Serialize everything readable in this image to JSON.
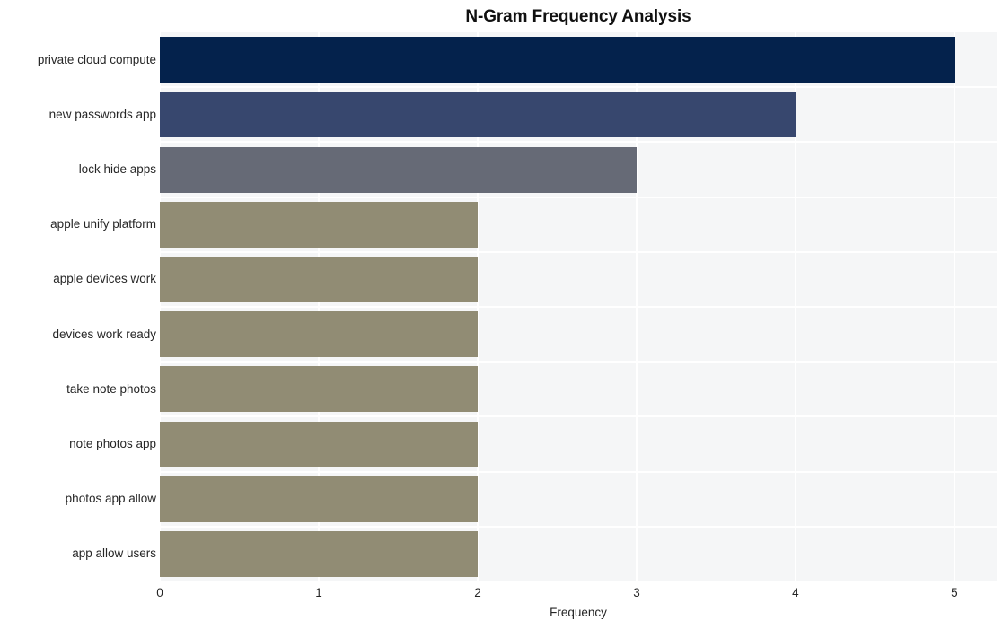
{
  "chart_data": {
    "type": "bar",
    "orientation": "horizontal",
    "title": "N-Gram Frequency Analysis",
    "xlabel": "Frequency",
    "ylabel": "",
    "categories": [
      "private cloud compute",
      "new passwords app",
      "lock hide apps",
      "apple unify platform",
      "apple devices work",
      "devices work ready",
      "take note photos",
      "note photos app",
      "photos app allow",
      "app allow users"
    ],
    "values": [
      5,
      4,
      3,
      2,
      2,
      2,
      2,
      2,
      2,
      2
    ],
    "bar_colors": [
      "#04224c",
      "#37476e",
      "#666a76",
      "#918c74",
      "#918c74",
      "#918c74",
      "#918c74",
      "#918c74",
      "#918c74",
      "#918c74"
    ],
    "xlim": [
      0,
      5.266
    ],
    "xticks": [
      0,
      1,
      2,
      3,
      4,
      5
    ],
    "xtick_labels": [
      "0",
      "1",
      "2",
      "3",
      "4",
      "5"
    ],
    "grid": true,
    "grid_color": "#ffffff",
    "plot_background": "#f5f6f7",
    "figure_background": "#ffffff",
    "legend": null
  }
}
